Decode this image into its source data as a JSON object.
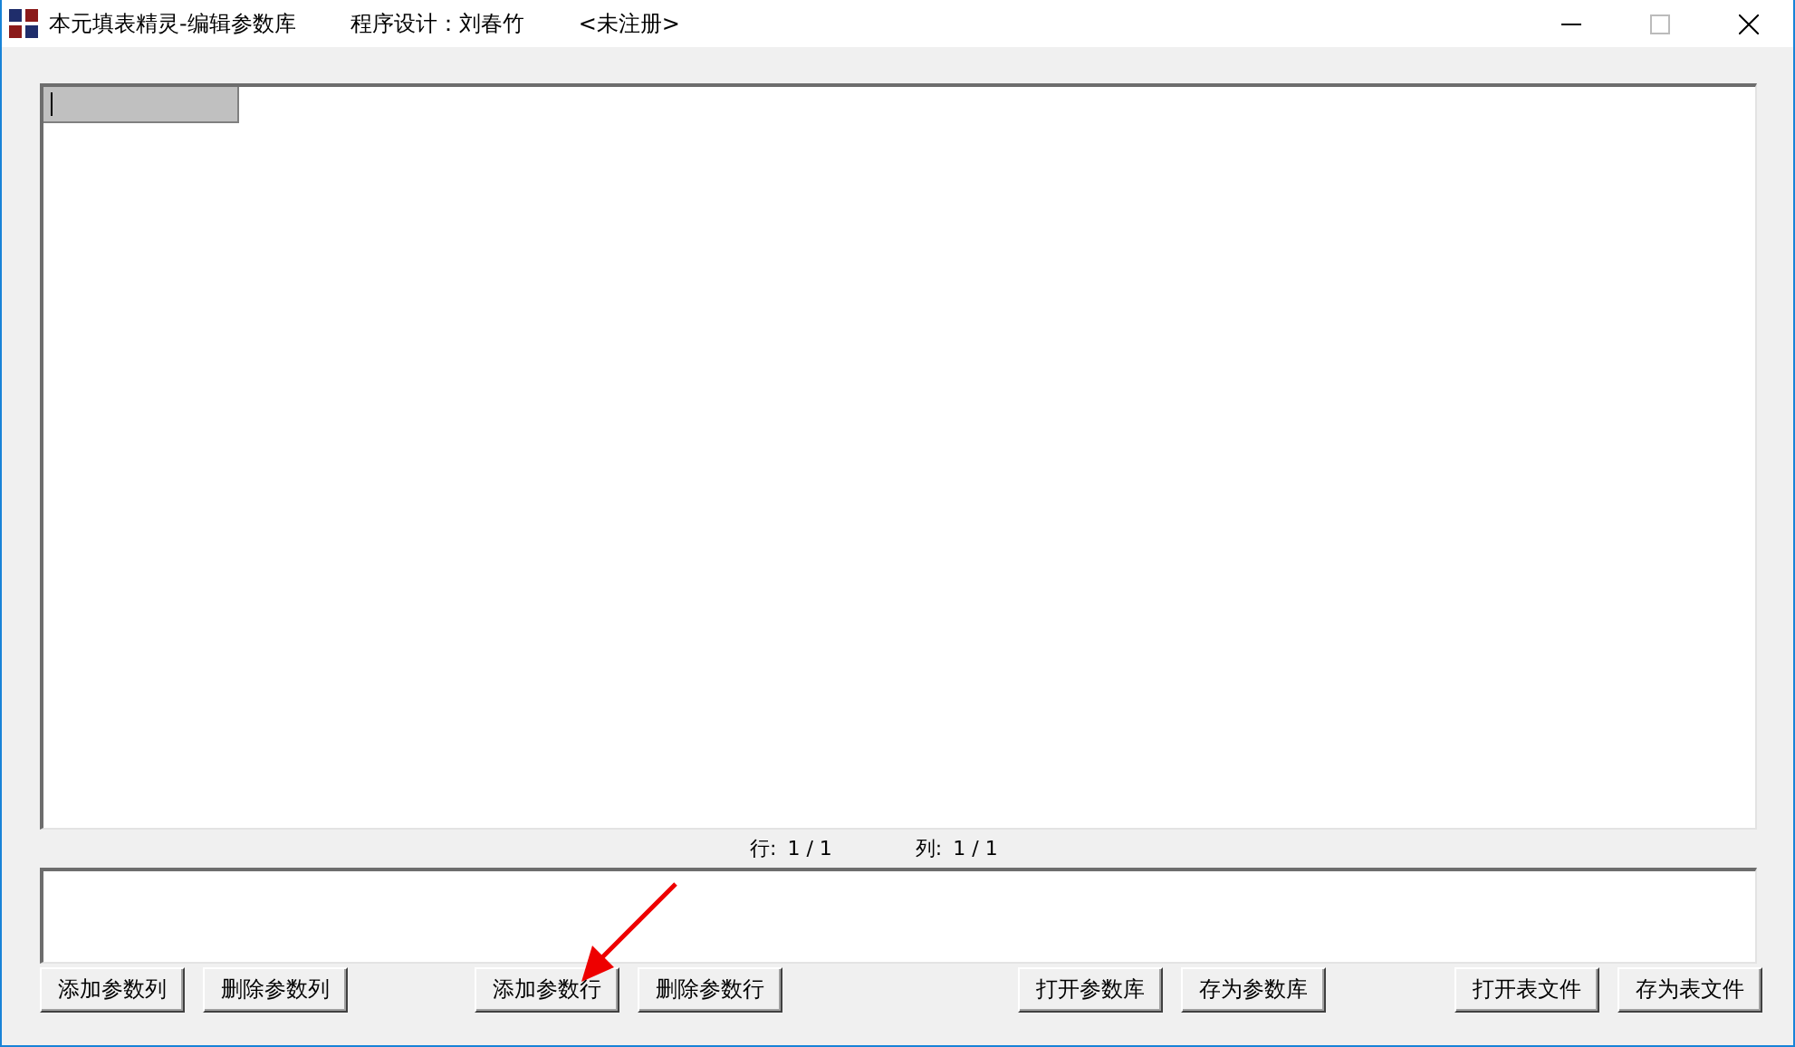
{
  "window": {
    "title": "本元填表精灵-编辑参数库",
    "designer": "程序设计：刘春竹",
    "registration": "<未注册>"
  },
  "status": {
    "row_label": "行:",
    "row_value": "1 / 1",
    "column_label": "列:",
    "column_value": "1 / 1"
  },
  "button_groups": [
    [
      "添加参数列",
      "删除参数列"
    ],
    [
      "添加参数行",
      "删除参数行"
    ],
    [
      "打开参数库",
      "存为参数库"
    ],
    [
      "打开表文件",
      "存为表文件"
    ]
  ]
}
